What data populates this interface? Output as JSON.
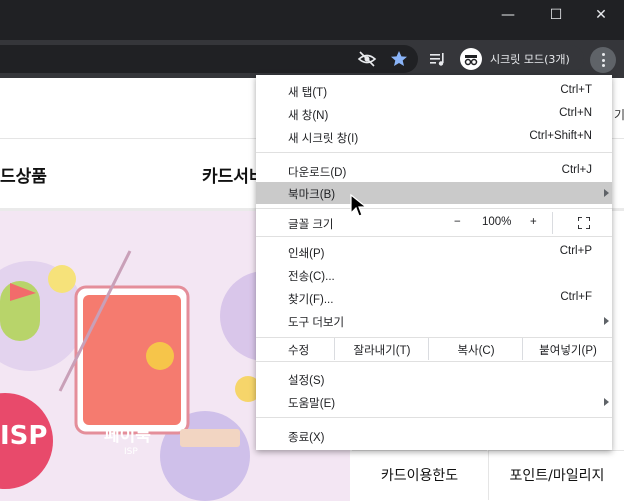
{
  "window": {
    "minimize_label": "—",
    "maximize_label": "☐",
    "close_label": "✕"
  },
  "toolbar": {
    "profile_label": "시크릿 모드(3개)",
    "icons": [
      "eye-off-icon",
      "bookmark-star-icon",
      "media-control-icon",
      "incognito-icon",
      "more-vert-icon"
    ]
  },
  "page": {
    "nav": [
      "드상품",
      "카드서비"
    ],
    "hero_title": "페이북",
    "hero_sub": "ISP",
    "badge_text": "ISP",
    "quick_links": [
      "카드이용한도",
      "포인트/마일리지"
    ],
    "right_edge_text": "기"
  },
  "menu": {
    "items": [
      {
        "label": "새 탭(T)",
        "shortcut": "Ctrl+T"
      },
      {
        "label": "새 창(N)",
        "shortcut": "Ctrl+N"
      },
      {
        "label": "새 시크릿 창(I)",
        "shortcut": "Ctrl+Shift+N"
      },
      {
        "label": "다운로드(D)",
        "shortcut": "Ctrl+J"
      },
      {
        "label": "북마크(B)",
        "shortcut": ""
      },
      {
        "label": "인쇄(P)",
        "shortcut": "Ctrl+P"
      },
      {
        "label": "전송(C)...",
        "shortcut": ""
      },
      {
        "label": "찾기(F)...",
        "shortcut": "Ctrl+F"
      },
      {
        "label": "도구 더보기",
        "shortcut": ""
      },
      {
        "label": "설정(S)",
        "shortcut": ""
      },
      {
        "label": "도움말(E)",
        "shortcut": ""
      },
      {
        "label": "종료(X)",
        "shortcut": ""
      }
    ],
    "zoom": {
      "label": "글꼴 크기",
      "minus": "−",
      "value": "100%",
      "plus": "+"
    },
    "edit": {
      "label": "수정",
      "cut": "잘라내기(T)",
      "copy": "복사(C)",
      "paste": "붙여넣기(P)"
    }
  }
}
